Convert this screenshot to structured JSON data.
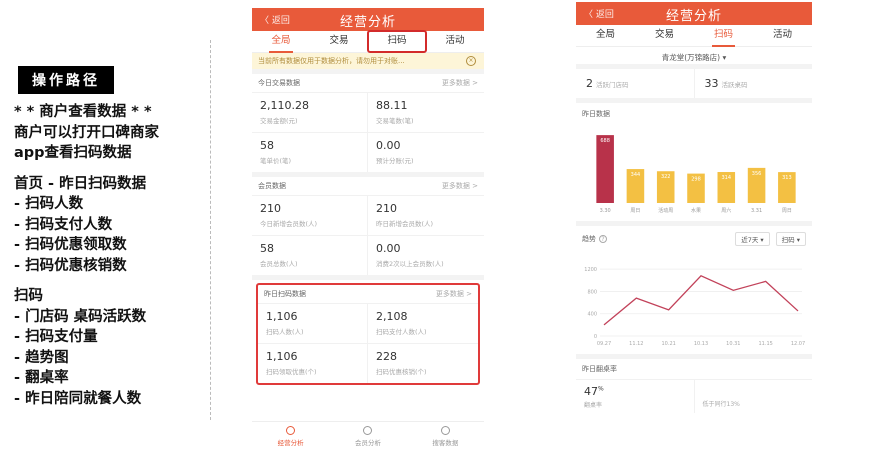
{
  "notes": {
    "tag": "操作路径",
    "lines": [
      "* * 商户查看数据 * *",
      "商户可以打开口碑商家",
      "app查看扫码数据",
      "",
      "首页 - 昨日扫码数据",
      " - 扫码人数",
      " - 扫码支付人数",
      " - 扫码优惠领取数",
      " - 扫码优惠核销数",
      "",
      "扫码",
      "   - 门店码 桌码活跃数",
      "  - 扫码支付量",
      "  - 趋势图",
      "   - 翻桌率",
      "   - 昨日陪同就餐人数"
    ]
  },
  "phone1": {
    "back": "〈 返回",
    "title": "经营分析",
    "tabs": [
      "全局",
      "交易",
      "扫码",
      "活动"
    ],
    "notice": "当前所有数据仅用于数据分析，请勿用于对账...",
    "notice_close": "×",
    "trade": {
      "head": "今日交易数据",
      "more": "更多数据 >",
      "cells": [
        {
          "num": "2,110.28",
          "label": "交易金额(元)"
        },
        {
          "num": "88.11",
          "label": "交易笔数(笔)"
        },
        {
          "num": "58",
          "label": "笔单价(笔)"
        },
        {
          "num": "0.00",
          "label": "预计分账(元)"
        }
      ]
    },
    "member": {
      "head": "会员数据",
      "more": "更多数据 >",
      "cells": [
        {
          "num": "210",
          "label": "今日新增会员数(人)"
        },
        {
          "num": "210",
          "label": "昨日新增会员数(人)"
        },
        {
          "num": "58",
          "label": "会员总数(人)"
        },
        {
          "num": "0.00",
          "label": "消费2次以上会员数(人)"
        }
      ]
    },
    "scan": {
      "head": "昨日扫码数据",
      "more": "更多数据 >",
      "cells": [
        {
          "num": "1,106",
          "label": "扫码人数(人)"
        },
        {
          "num": "2,108",
          "label": "扫码支付人数(人)"
        },
        {
          "num": "1,106",
          "label": "扫码领取优惠(个)"
        },
        {
          "num": "228",
          "label": "扫码优惠核销(个)"
        }
      ]
    },
    "bottom": [
      "经营分析",
      "会员分析",
      "搜客数据"
    ]
  },
  "phone2": {
    "back": "〈 返回",
    "title": "经营分析",
    "tabs": [
      "全局",
      "交易",
      "扫码",
      "活动"
    ],
    "store": "青龙堂(万锦路店)  ▾",
    "kpi": [
      {
        "num": "2",
        "label": "活跃门店码"
      },
      {
        "num": "33",
        "label": "活跃桌码"
      }
    ],
    "bar_title": "昨日数据",
    "trend_label": "趋势",
    "trend_q": "?",
    "dropdowns": [
      "近7天 ▾",
      "扫码 ▾"
    ],
    "turn_head": "昨日翻桌率",
    "turn_value": "47",
    "turn_unit": "%",
    "turn_label": "翻桌率",
    "turn_right": "低于同行13%"
  },
  "chart_data": [
    {
      "type": "bar",
      "categories": [
        "3.30",
        "周日",
        "活动周",
        "水果",
        "周六",
        "3.31",
        "周日"
      ],
      "values": [
        688,
        344,
        322,
        298,
        314,
        356,
        313
      ],
      "ylim": [
        0,
        750
      ],
      "colors": [
        "#b8324a",
        "#f3c043"
      ]
    },
    {
      "type": "line",
      "x": [
        "09.27",
        "11.12",
        "10.21",
        "10.13",
        "10.31",
        "11.15",
        "12.07"
      ],
      "values": [
        200,
        680,
        470,
        1080,
        820,
        980,
        450
      ],
      "yticks": [
        0,
        400,
        800,
        1200
      ],
      "ylim": [
        0,
        1400
      ],
      "color": "#c2425a"
    }
  ]
}
